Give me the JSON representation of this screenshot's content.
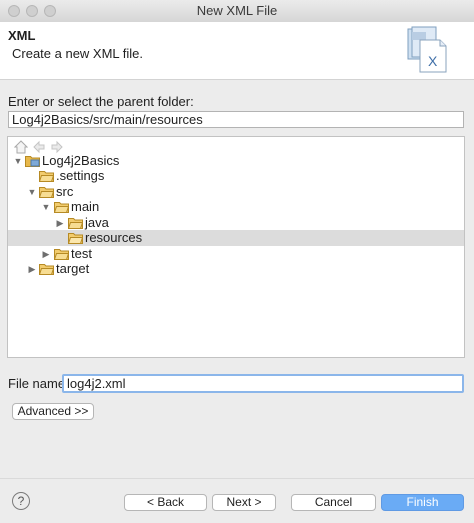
{
  "window": {
    "title": "New XML File"
  },
  "header": {
    "title": "XML",
    "description": "Create a new XML file."
  },
  "parent_folder": {
    "label": "Enter or select the parent folder:",
    "value": "Log4j2Basics/src/main/resources"
  },
  "tree": {
    "toolbar_icons": [
      "home-icon",
      "back-arrow-icon",
      "forward-arrow-icon"
    ],
    "items": [
      {
        "label": "Log4j2Basics",
        "icon": "project-folder-icon",
        "expanded": true
      },
      {
        "label": ".settings",
        "icon": "folder-icon",
        "expanded": false
      },
      {
        "label": "src",
        "icon": "folder-icon",
        "expanded": true
      },
      {
        "label": "main",
        "icon": "folder-icon",
        "expanded": true
      },
      {
        "label": "java",
        "icon": "folder-icon",
        "expanded": false
      },
      {
        "label": "resources",
        "icon": "folder-open-icon",
        "expanded": false,
        "selected": true
      },
      {
        "label": "test",
        "icon": "folder-icon",
        "expanded": false
      },
      {
        "label": "target",
        "icon": "folder-icon",
        "expanded": false
      }
    ]
  },
  "file_name": {
    "label": "File name:",
    "value": "log4j2.xml"
  },
  "buttons": {
    "advanced": "Advanced >>",
    "back": "< Back",
    "next": "Next >",
    "cancel": "Cancel",
    "finish": "Finish",
    "help": "?"
  },
  "colors": {
    "accent": "#6aabf5",
    "focus": "#8bb6ea",
    "selection": "#dcdcdc",
    "folder": "#e8b84a"
  }
}
